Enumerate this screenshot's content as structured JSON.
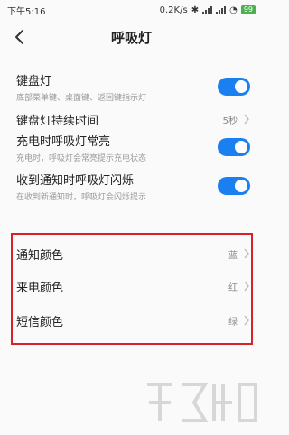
{
  "status": {
    "time": "下午5:16",
    "speed": "0.2K/s",
    "battery": "99"
  },
  "header": {
    "title": "呼吸灯"
  },
  "rows": [
    {
      "label": "键盘灯",
      "sub": "底部菜单键、桌面键、返回键指示灯",
      "toggle": true
    },
    {
      "label": "键盘灯持续时间",
      "value": "5秒"
    },
    {
      "label": "充电时呼吸灯常亮",
      "sub": "充电时，呼吸灯会常亮提示充电状态",
      "toggle": true
    },
    {
      "label": "收到通知时呼吸灯闪烁",
      "sub": "在收到新通知时，呼吸灯会闪烁提示",
      "toggle": true
    },
    {
      "label": "通知颜色",
      "value": "蓝"
    },
    {
      "label": "来电颜色",
      "value": "红"
    },
    {
      "label": "短信颜色",
      "value": "绿"
    }
  ],
  "colors": {
    "accent": "#1a80f0",
    "highlight": "#d9212a"
  }
}
